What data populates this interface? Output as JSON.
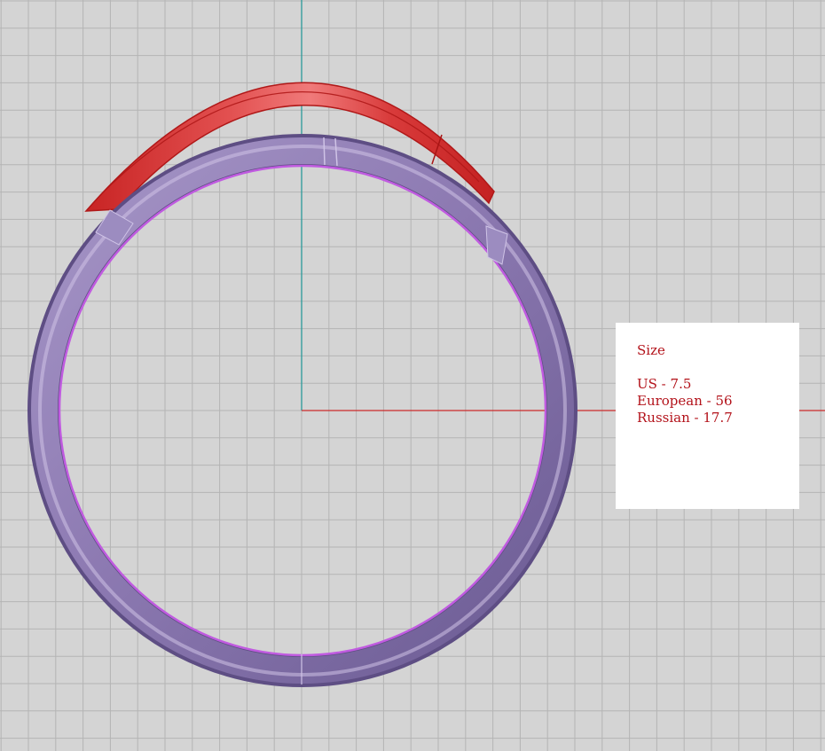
{
  "viewport": {
    "background": "#d4d4d4",
    "grid_color": "#b4b4b4",
    "x_axis_color": "#cc2a2a",
    "y_axis_color": "#2a9a9a"
  },
  "ring": {
    "band_color": "#8d7ab2",
    "band_shadow_color": "#5e4e84",
    "band_highlight_color": "#cfc3e6",
    "inner_edge_color": "#c05be0",
    "setting_color": "#d93636",
    "setting_edge_color": "#b01818",
    "setting_highlight_color": "#f07878"
  },
  "size_panel": {
    "heading": "Size",
    "us": "US - 7.5",
    "european": "European - 56",
    "russian": "Russian - 17.7",
    "text_color": "#b3131b"
  }
}
